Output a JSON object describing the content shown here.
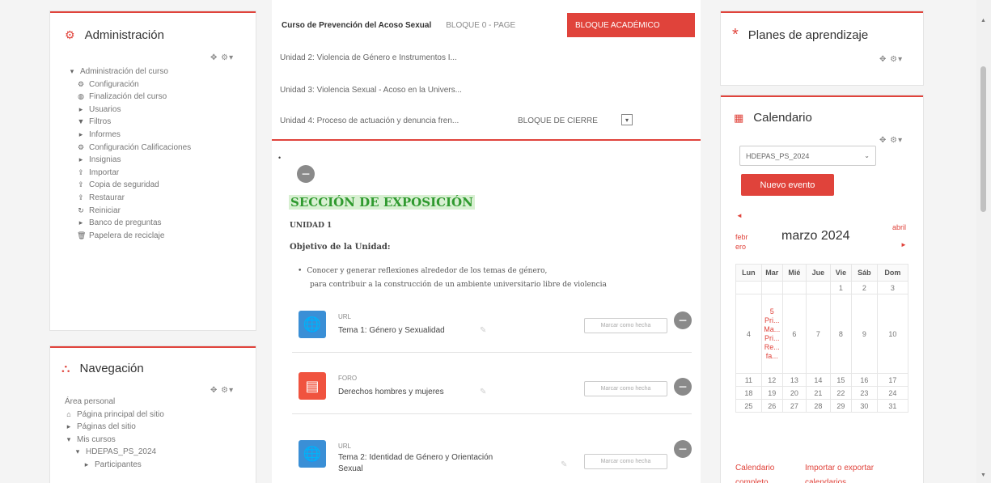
{
  "admin": {
    "title": "Administración",
    "controls": "✥ ⚙▾",
    "items": [
      {
        "icon": "▾",
        "label": "Administración del curso",
        "indent": 0
      },
      {
        "icon": "⚙",
        "label": "Configuración",
        "indent": 1
      },
      {
        "icon": "◍",
        "label": "Finalización del curso",
        "indent": 1
      },
      {
        "icon": "▸",
        "label": "Usuarios",
        "indent": 1
      },
      {
        "icon": "▼",
        "label": "Filtros",
        "indent": 1
      },
      {
        "icon": "▸",
        "label": "Informes",
        "indent": 1
      },
      {
        "icon": "⚙",
        "label": "Configuración Calificaciones",
        "indent": 1
      },
      {
        "icon": "▸",
        "label": "Insignias",
        "indent": 1
      },
      {
        "icon": "⇪",
        "label": "Importar",
        "indent": 1
      },
      {
        "icon": "⇪",
        "label": "Copia de seguridad",
        "indent": 1
      },
      {
        "icon": "⇪",
        "label": "Restaurar",
        "indent": 1
      },
      {
        "icon": "↻",
        "label": "Reiniciar",
        "indent": 1
      },
      {
        "icon": "▸",
        "label": "Banco de preguntas",
        "indent": 1
      },
      {
        "icon": "🗑",
        "label": "Papelera de reciclaje",
        "indent": 1
      }
    ]
  },
  "nav": {
    "title": "Navegación",
    "controls": "✥ ⚙▾",
    "items": [
      {
        "icon": "",
        "label": "Área personal",
        "indent": 0
      },
      {
        "icon": "⌂",
        "label": "Página principal del sitio",
        "indent": 0
      },
      {
        "icon": "▸",
        "label": "Páginas del sitio",
        "indent": 0
      },
      {
        "icon": "▾",
        "label": "Mis cursos",
        "indent": 0
      },
      {
        "icon": "▾",
        "label": "HDEPAS_PS_2024",
        "indent": 1
      },
      {
        "icon": "▸",
        "label": "Participantes",
        "indent": 2
      }
    ]
  },
  "tabs": {
    "course": "Curso de Prevención del Acoso Sexual",
    "bloque0": "BLOQUE 0 - PAGE",
    "academico": "BLOQUE ACADÉMICO",
    "cierre": "BLOQUE DE CIERRE"
  },
  "units": [
    "Unidad 2: Violencia de Género e Instrumentos I...",
    "Unidad 3: Violencia Sexual - Acoso en la Univers...",
    "Unidad 4: Proceso de actuación y denuncia fren..."
  ],
  "section": {
    "title": "SECCIÓN DE EXPOSICIÓN",
    "unit": "UNIDAD 1",
    "objective_label": "Objetivo de la Unidad:",
    "bullet_line1": "Conocer y generar reflexiones alrededor de los temas de género,",
    "bullet_line2": "para contribuir a la construcción de un ambiente universitario libre de violencia"
  },
  "activities": [
    {
      "type": "URL",
      "name": "Tema 1: Género y Sexualidad",
      "name2": "",
      "mark": "Marcar como hecha",
      "color": "#3a8fd6",
      "icon": "🌐"
    },
    {
      "type": "FORO",
      "name": "Derechos hombres y mujeres",
      "name2": "",
      "mark": "Marcar como hecha",
      "color": "#f0533f",
      "icon": "▤"
    },
    {
      "type": "URL",
      "name": "Tema 2: Identidad de Género y Orientación",
      "name2": "Sexual",
      "mark": "Marcar como hecha",
      "color": "#3a8fd6",
      "icon": "🌐"
    }
  ],
  "plans": {
    "title": "Planes de aprendizaje",
    "controls": "✥ ⚙▾"
  },
  "calendar": {
    "title": "Calendario",
    "controls": "✥ ⚙▾",
    "select": "HDEPAS_PS_2024",
    "new_event": "Nuevo evento",
    "prev_line1": "febr",
    "prev_line2": "ero",
    "month": "marzo 2024",
    "next": "abril",
    "weekdays": [
      "Lun",
      "Mar",
      "Mié",
      "Jue",
      "Vie",
      "Sáb",
      "Dom"
    ],
    "rows": [
      [
        "",
        "",
        "",
        "",
        "1",
        "2",
        "3"
      ],
      [
        "4",
        "5 Pri... Ma... Pri... Re... fa...",
        "6",
        "7",
        "8",
        "9",
        "10"
      ],
      [
        "11",
        "12",
        "13",
        "14",
        "15",
        "16",
        "17"
      ],
      [
        "18",
        "19",
        "20",
        "21",
        "22",
        "23",
        "24"
      ],
      [
        "25",
        "26",
        "27",
        "28",
        "29",
        "30",
        "31"
      ]
    ],
    "link_full": "Calendario completo",
    "link_export": "Importar o exportar calendarios"
  },
  "colors": {
    "accent": "#e0433b",
    "section_title": "#2f9a2f",
    "section_bg": "#d8f0d2"
  }
}
